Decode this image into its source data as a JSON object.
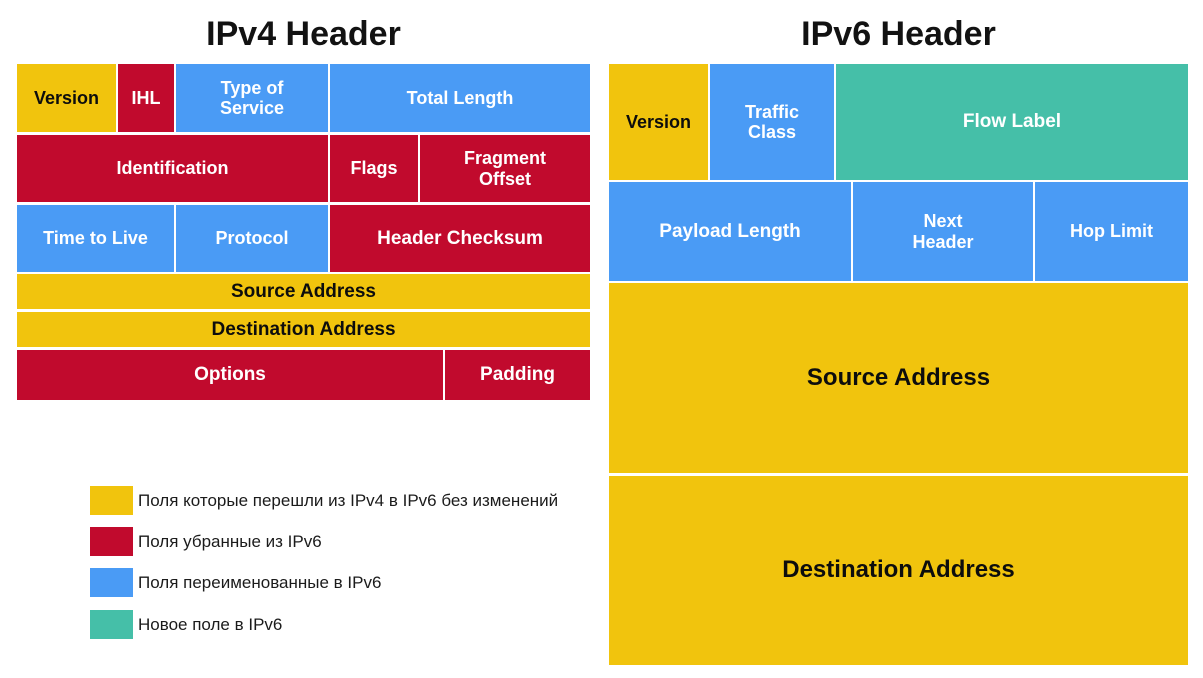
{
  "colors": {
    "unchanged": "#F1C40D",
    "removed": "#C10A2D",
    "renamed": "#4A9BF5",
    "new": "#45BFA8",
    "background": "#FFFFFF",
    "title_text": "#121212"
  },
  "ipv4": {
    "title": "IPv4 Header",
    "fields": [
      {
        "label": "Version",
        "category": "unchanged"
      },
      {
        "label": "IHL",
        "category": "removed"
      },
      {
        "label": "Type of\nService",
        "category": "renamed"
      },
      {
        "label": "Total Length",
        "category": "renamed"
      },
      {
        "label": "Identification",
        "category": "removed"
      },
      {
        "label": "Flags",
        "category": "removed"
      },
      {
        "label": "Fragment\nOffset",
        "category": "removed"
      },
      {
        "label": "Time to Live",
        "category": "renamed"
      },
      {
        "label": "Protocol",
        "category": "renamed"
      },
      {
        "label": "Header Checksum",
        "category": "removed"
      },
      {
        "label": "Source Address",
        "category": "unchanged"
      },
      {
        "label": "Destination Address",
        "category": "unchanged"
      },
      {
        "label": "Options",
        "category": "removed"
      },
      {
        "label": "Padding",
        "category": "removed"
      }
    ]
  },
  "ipv6": {
    "title": "IPv6 Header",
    "fields": [
      {
        "label": "Version",
        "category": "unchanged"
      },
      {
        "label": "Traffic\nClass",
        "category": "renamed"
      },
      {
        "label": "Flow Label",
        "category": "new"
      },
      {
        "label": "Payload Length",
        "category": "renamed"
      },
      {
        "label": "Next\nHeader",
        "category": "renamed"
      },
      {
        "label": "Hop Limit",
        "category": "renamed"
      },
      {
        "label": "Source Address",
        "category": "unchanged"
      },
      {
        "label": "Destination Address",
        "category": "unchanged"
      }
    ]
  },
  "legend": {
    "items": [
      {
        "color_key": "unchanged",
        "label": "Поля которые перешли из IPv4 в IPv6 без изменений"
      },
      {
        "color_key": "removed",
        "label": "Поля убранные из IPv6"
      },
      {
        "color_key": "renamed",
        "label": "Поля переименованные в IPv6"
      },
      {
        "color_key": "new",
        "label": "Новое поле в IPv6"
      }
    ]
  }
}
